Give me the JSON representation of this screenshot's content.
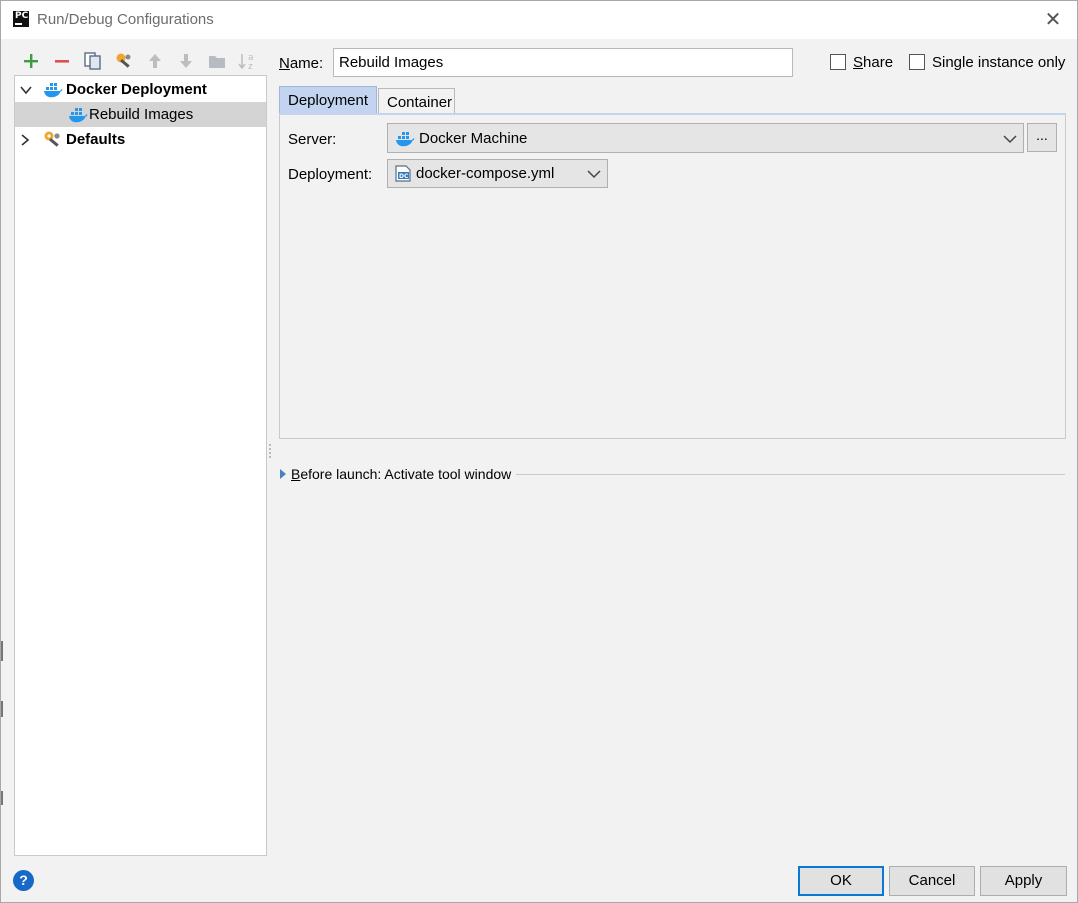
{
  "window": {
    "title": "Run/Debug Configurations",
    "app_icon_text": "PC"
  },
  "tree": {
    "items": [
      {
        "label": "Docker Deployment",
        "expanded": true,
        "icon": "docker-icon",
        "bold": true
      },
      {
        "label": "Rebuild Images",
        "selected": true,
        "icon": "docker-icon",
        "bold": false
      },
      {
        "label": "Defaults",
        "expanded": false,
        "icon": "wrench-gear-icon",
        "bold": true
      }
    ]
  },
  "form": {
    "name_label": "Name:",
    "name_value": "Rebuild Images",
    "share_label": "Share",
    "single_instance_label": "Single instance only",
    "share_checked": false,
    "single_instance_checked": false
  },
  "tabs": [
    {
      "label": "Deployment",
      "active": true
    },
    {
      "label": "Container",
      "active": false
    }
  ],
  "deployment_tab": {
    "server_label": "Server:",
    "server_value": "Docker Machine",
    "ellipsis_label": "...",
    "deployment_label": "Deployment:",
    "deployment_value": "docker-compose.yml"
  },
  "before_launch": {
    "text": "Before launch: Activate tool window"
  },
  "buttons": {
    "help": "?",
    "ok": "OK",
    "cancel": "Cancel",
    "apply": "Apply"
  },
  "colors": {
    "accent_blue": "#0a78d7",
    "tab_active": "#c2d4ef",
    "docker_blue": "#2496ed",
    "add_green": "#3e9b3e",
    "remove_red": "#d9534f"
  }
}
